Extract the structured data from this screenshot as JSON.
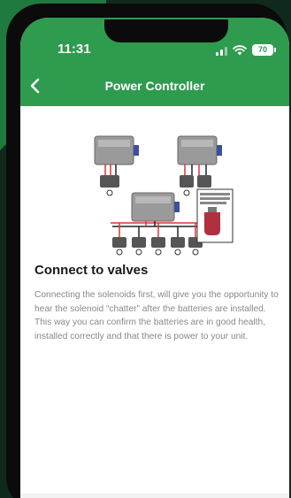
{
  "colors": {
    "accent": "#2e9b4f",
    "page_bg": "#0f2a1c",
    "body_text": "#888888"
  },
  "status_bar": {
    "time": "11:31",
    "battery": "70",
    "icons": [
      "signal-icon",
      "wifi-icon",
      "battery-icon"
    ]
  },
  "nav": {
    "title": "Power Controller",
    "back_icon": "chevron-left-icon"
  },
  "content": {
    "heading": "Connect to valves",
    "body": "Connecting the solenoids first, will give you the opportunity to hear the solenoid “chatter” after the batteries are installed. This way you can confirm the batteries are in good health, installed correctly and that there is power to your unit."
  }
}
